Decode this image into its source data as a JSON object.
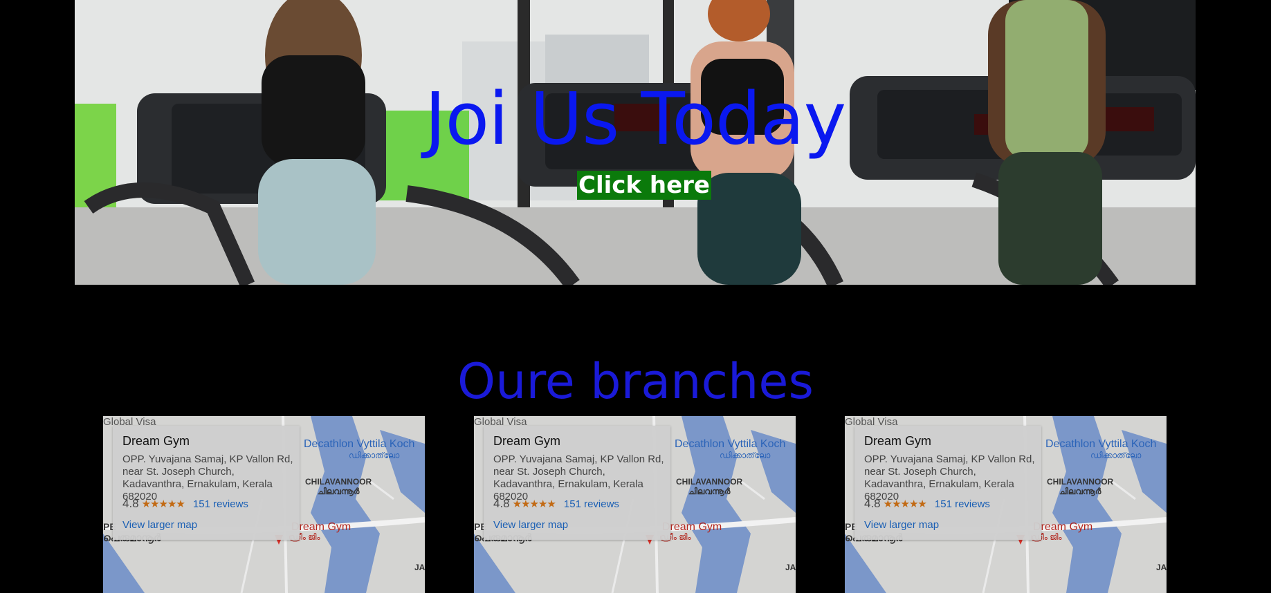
{
  "hero": {
    "title": "Joi Us Today",
    "button_label": "Click here",
    "title_color": "#0a18f0",
    "button_color": "#0b7a0b"
  },
  "branches": {
    "title": "Oure branches",
    "title_color": "#1a1ad8",
    "maps": [
      {
        "place_name": "Dream Gym",
        "address": "OPP. Yuvajana Samaj, KP Vallon Rd, near St. Joseph Church, Kadavanthra, Ernakulam, Kerala 682020",
        "rating": "4.8",
        "stars": "★★★★★",
        "reviews": "151 reviews",
        "larger_map": "View larger map",
        "labels": {
          "top_left": "Global Visa",
          "decathlon": "Decathlon Vyttila Koch",
          "decathlon_ml": "ഡിക്കാത്‌ലോ",
          "chilavannoor": "CHILAVANNOOR",
          "chilavannoor_ml": "ചിലവന്നൂർ",
          "gym_label": "Dream Gym",
          "gym_label_ml": "ഡ്രീം ജിം",
          "perumanoor_ml": "പെരുമാനൂർ",
          "edge_left": "PE",
          "edge_right": "JA"
        }
      },
      {
        "place_name": "Dream Gym",
        "address": "OPP. Yuvajana Samaj, KP Vallon Rd, near St. Joseph Church, Kadavanthra, Ernakulam, Kerala 682020",
        "rating": "4.8",
        "stars": "★★★★★",
        "reviews": "151 reviews",
        "larger_map": "View larger map",
        "labels": {
          "top_left": "Global Visa",
          "decathlon": "Decathlon Vyttila Koch",
          "decathlon_ml": "ഡിക്കാത്‌ലോ",
          "chilavannoor": "CHILAVANNOOR",
          "chilavannoor_ml": "ചിലവന്നൂർ",
          "gym_label": "Dream Gym",
          "gym_label_ml": "ഡ്രീം ജിം",
          "perumanoor_ml": "പെരുമാനൂർ",
          "edge_left": "PE",
          "edge_right": "JA"
        }
      },
      {
        "place_name": "Dream Gym",
        "address": "OPP. Yuvajana Samaj, KP Vallon Rd, near St. Joseph Church, Kadavanthra, Ernakulam, Kerala 682020",
        "rating": "4.8",
        "stars": "★★★★★",
        "reviews": "151 reviews",
        "larger_map": "View larger map",
        "labels": {
          "top_left": "Global Visa",
          "decathlon": "Decathlon Vyttila Koch",
          "decathlon_ml": "ഡിക്കാത്‌ലോ",
          "chilavannoor": "CHILAVANNOOR",
          "chilavannoor_ml": "ചിലവന്നൂർ",
          "gym_label": "Dream Gym",
          "gym_label_ml": "ഡ്രീം ജിം",
          "perumanoor_ml": "പെരുമാനൂർ",
          "edge_left": "PE",
          "edge_right": "JA"
        }
      }
    ]
  }
}
